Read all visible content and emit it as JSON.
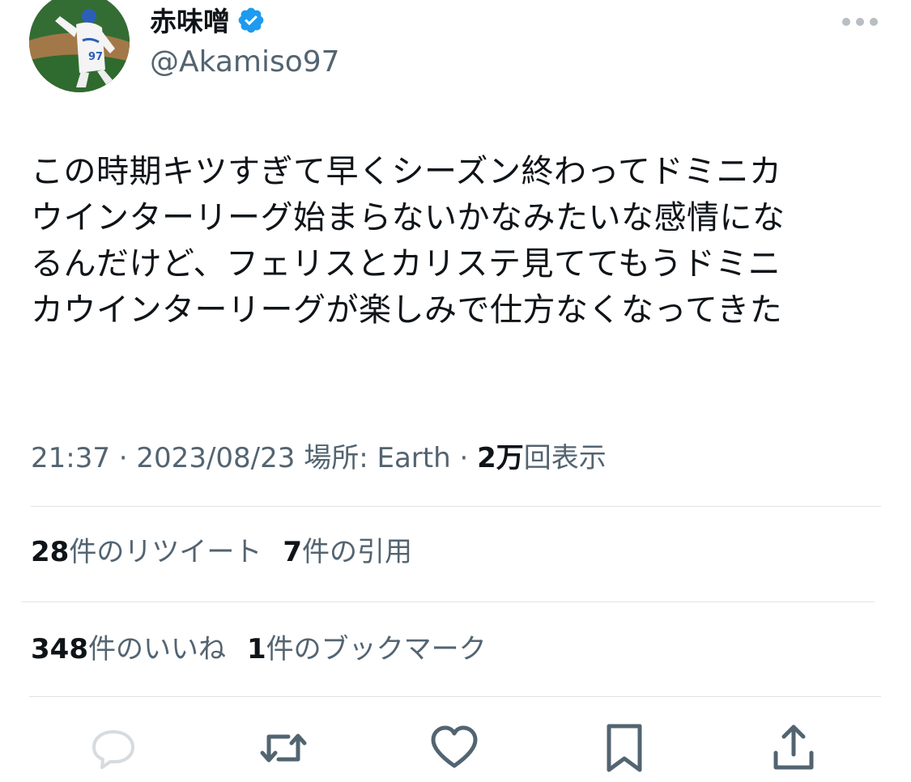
{
  "author": {
    "display_name": "赤味噌",
    "handle": "@Akamiso97",
    "verified_icon": "verified-badge-icon",
    "verified_color": "#1d9bf0"
  },
  "tweet": {
    "lines": [
      "この時期キツすぎて早くシーズン終わってドミニカ",
      "ウインターリーグ始まらないかなみたいな感情にな",
      "るんだけど、フェリスとカリステ見ててもうドミニ",
      "カウインターリーグが楽しみで仕方なくなってきた"
    ]
  },
  "meta": {
    "time": "21:37",
    "separator": "·",
    "date": "2023/08/23",
    "location_label": "場所: Earth",
    "views_count": "2万",
    "views_label": "回表示"
  },
  "stats": {
    "retweets_count": "28",
    "retweets_label": "件のリツイート",
    "quotes_count": "7",
    "quotes_label": "件の引用",
    "likes_count": "348",
    "likes_label": "件のいいね",
    "bookmarks_count": "1",
    "bookmarks_label": "件のブックマーク"
  },
  "actions": [
    {
      "name": "reply",
      "icon": "reply-icon"
    },
    {
      "name": "retweet",
      "icon": "retweet-icon"
    },
    {
      "name": "like",
      "icon": "heart-icon"
    },
    {
      "name": "bookmark",
      "icon": "bookmark-icon"
    },
    {
      "name": "share",
      "icon": "share-icon"
    }
  ],
  "colors": {
    "text_primary": "#0f1419",
    "text_secondary": "#536471",
    "divider": "#dfe3e6",
    "action_icon": "#536471"
  }
}
